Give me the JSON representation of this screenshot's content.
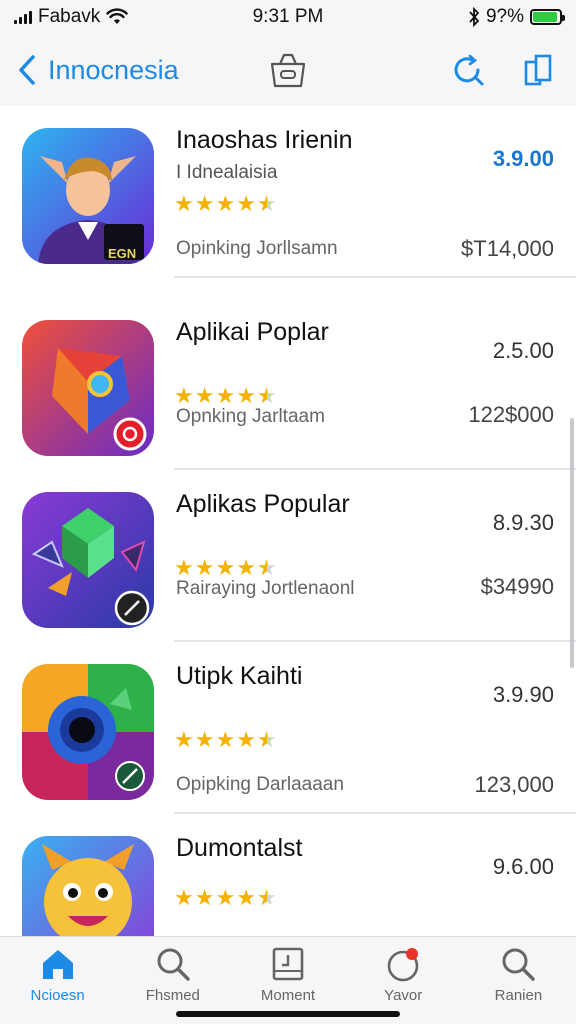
{
  "status_bar": {
    "carrier": "Fabavk",
    "time": "9:31 PM",
    "battery": "9?%",
    "battery_level": 0.92
  },
  "nav": {
    "back_label": "Innocnesia"
  },
  "apps": [
    {
      "title": "Inaoshas Irienin",
      "subtitle": "I Idnealaisia",
      "rating": 4.5,
      "meta": "Opinking  Jorllsamn",
      "version": "3.9.00",
      "version_highlight": true,
      "price": "$T14,000",
      "icon_text": "EGN"
    },
    {
      "title": "Aplikai Poplar",
      "subtitle": "",
      "rating": 4.5,
      "meta": "Opnking  Jarltaam",
      "version": "2.5.00",
      "version_highlight": false,
      "price": "122$000",
      "icon_text": ""
    },
    {
      "title": "Aplikas Popular",
      "subtitle": "",
      "rating": 4.5,
      "meta": "Rairaying  Jortlenaonl",
      "version": "8.9.30",
      "version_highlight": false,
      "price": "$34990",
      "icon_text": ""
    },
    {
      "title": "Utipk Kaihti",
      "subtitle": "",
      "rating": 4.5,
      "meta": "Opipking  Darlaaaan",
      "version": "3.9.90",
      "version_highlight": false,
      "price": "123,000",
      "icon_text": ""
    },
    {
      "title": "Dumontalst",
      "subtitle": "",
      "rating": 4.5,
      "meta": "",
      "version": "9.6.00",
      "version_highlight": false,
      "price": "",
      "icon_text": ""
    }
  ],
  "tabs": [
    {
      "label": "Ncioesn",
      "icon": "home-icon",
      "active": true
    },
    {
      "label": "Fhsmed",
      "icon": "search-icon",
      "active": false
    },
    {
      "label": "Moment",
      "icon": "calendar-icon",
      "active": false
    },
    {
      "label": "Yavor",
      "icon": "notification-icon",
      "active": false
    },
    {
      "label": "Ranien",
      "icon": "search-icon",
      "active": false
    }
  ],
  "colors": {
    "accent": "#1d8ae6",
    "star": "#f5b301",
    "battery": "#2ecc40"
  }
}
